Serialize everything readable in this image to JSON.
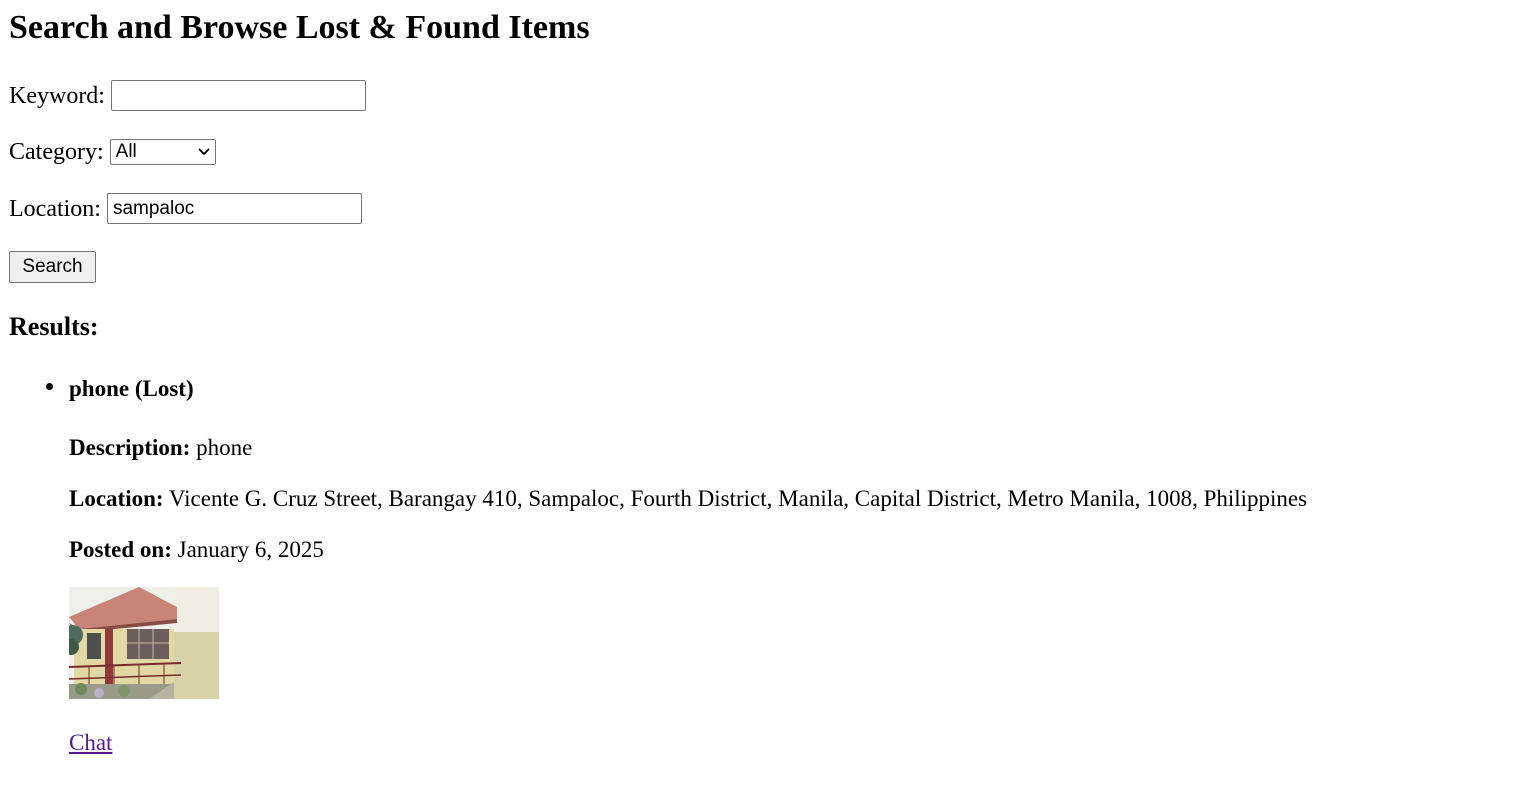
{
  "page": {
    "title": "Search and Browse Lost & Found Items"
  },
  "form": {
    "keyword_label": "Keyword:",
    "keyword_value": "",
    "category_label": "Category:",
    "category_selected": "All",
    "location_label": "Location:",
    "location_value": "sampaloc",
    "search_button": "Search"
  },
  "results": {
    "heading": "Results:",
    "items": [
      {
        "title": "phone (Lost)",
        "description_label": "Description:",
        "description": "phone",
        "location_label": "Location:",
        "location": "Vicente G. Cruz Street, Barangay 410, Sampaloc, Fourth District, Manila, Capital District, Metro Manila, 1008, Philippines",
        "posted_label": "Posted on:",
        "posted": "January 6, 2025",
        "chat_link": "Chat"
      }
    ]
  },
  "colors": {
    "link_visited": "#551a8b",
    "button_bg": "#efefef",
    "input_border": "#767676"
  },
  "icons": {
    "select_arrow": "chevron-down-icon"
  }
}
